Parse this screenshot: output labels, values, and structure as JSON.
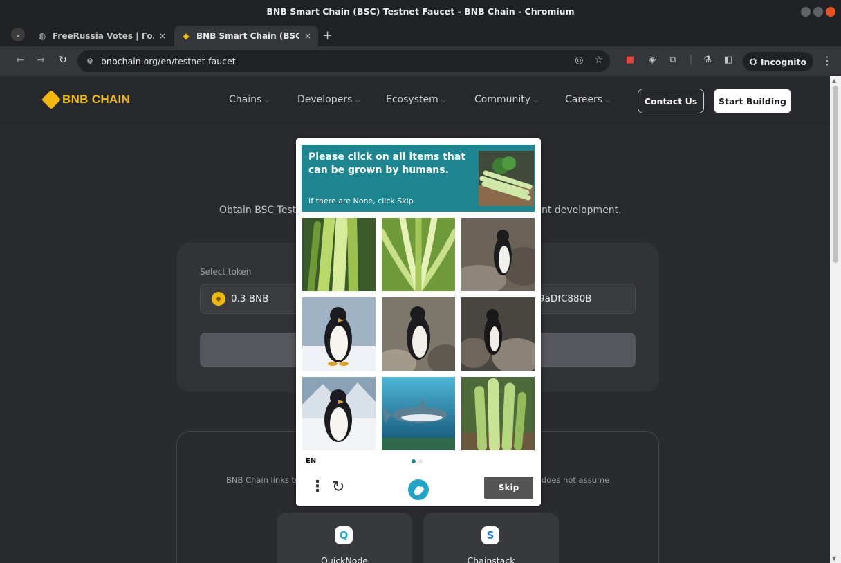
{
  "window": {
    "title": "BNB Smart Chain (BSC) Testnet Faucet - BNB Chain - Chromium"
  },
  "tabs": [
    {
      "label": "FreeRussia Votes | Голо",
      "close": "×"
    },
    {
      "label": "BNB Smart Chain (BSC) T",
      "close": "×"
    }
  ],
  "toolbar": {
    "url": "bnbchain.org/en/testnet-faucet",
    "incognito_label": "Incognito"
  },
  "site": {
    "logo": "BNB CHAIN",
    "nav": [
      "Chains",
      "Developers",
      "Ecosystem",
      "Community",
      "Careers"
    ],
    "contact_label": "Contact Us",
    "start_label": "Start Building",
    "subtitle_left": "Obtain BSC Testn",
    "subtitle_right": "nt development.",
    "select_label": "Select token",
    "token_value": "0.3 BNB",
    "address_value": "9aDfC880B",
    "disclaimer_left": "BNB Chain links to",
    "disclaimer_right": "does not assume",
    "partners": [
      {
        "name": "QuickNode",
        "icon": "Q",
        "color": "#1ea5d8"
      },
      {
        "name": "Chainstack",
        "icon": "S",
        "color": "#1d7fe0"
      }
    ]
  },
  "captcha": {
    "prompt": "Please click on all items that can be grown by humans.",
    "hint": "If there are None, click Skip",
    "tiles": [
      "celery-closeup",
      "plant-leaves",
      "penguin-rocks",
      "penguin-snow",
      "penguin-rocks",
      "penguin-beach",
      "penguin-snow",
      "shark-underwater",
      "celery-bunch"
    ],
    "language": "EN",
    "skip_label": "Skip",
    "accent": "#1c8590"
  }
}
